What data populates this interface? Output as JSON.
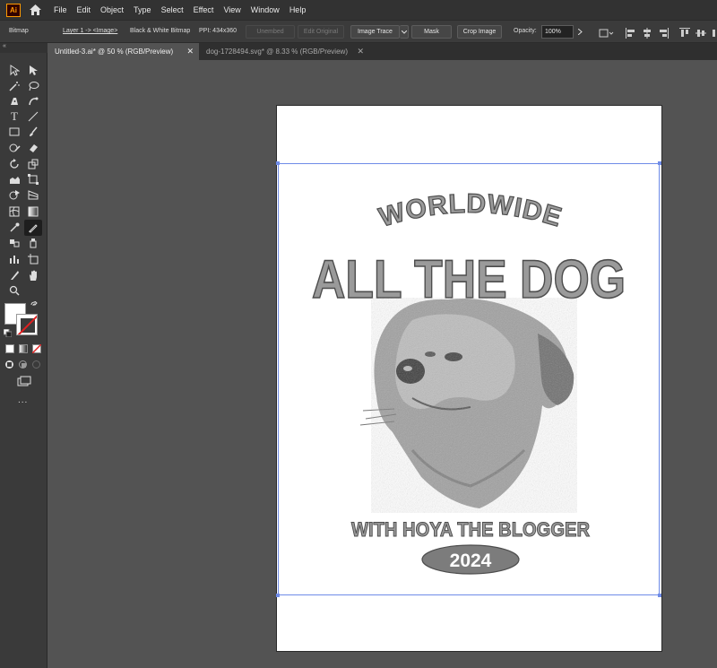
{
  "app": {
    "logo_label": "Ai",
    "home_icon": "home-icon",
    "menu": [
      "File",
      "Edit",
      "Object",
      "Type",
      "Select",
      "Effect",
      "View",
      "Window",
      "Help"
    ]
  },
  "control_bar": {
    "selection_type": "Bitmap",
    "layer_path": "Layer 1 -> <Image>",
    "color_mode": "Black & White Bitmap",
    "ppi": "PPI: 434x360",
    "unembed_label": "Unembed",
    "edit_original_label": "Edit Original",
    "image_trace_label": "Image Trace",
    "mask_label": "Mask",
    "crop_image_label": "Crop Image",
    "opacity_label": "Opacity:",
    "opacity_value": "100%"
  },
  "tabs": [
    {
      "label": "Untitled-3.ai* @ 50 % (RGB/Preview)",
      "active": true
    },
    {
      "label": "dog-1728494.svg* @ 8.33 % (RGB/Preview)",
      "active": false
    }
  ],
  "toolbar": {
    "collapse_label": "«",
    "more_label": "..."
  },
  "artwork": {
    "line1": "WORLDWIDE",
    "line2": "ALL THE DOG",
    "line3": "WITH HOYA THE BLOGGER",
    "year": "2024",
    "fill_color": "#9a9a9a",
    "stroke_color": "#4d4d4d"
  },
  "colors": {
    "selection_blue": "#6f8ce8",
    "menubar_bg": "#323232",
    "canvas_bg": "#535353"
  }
}
